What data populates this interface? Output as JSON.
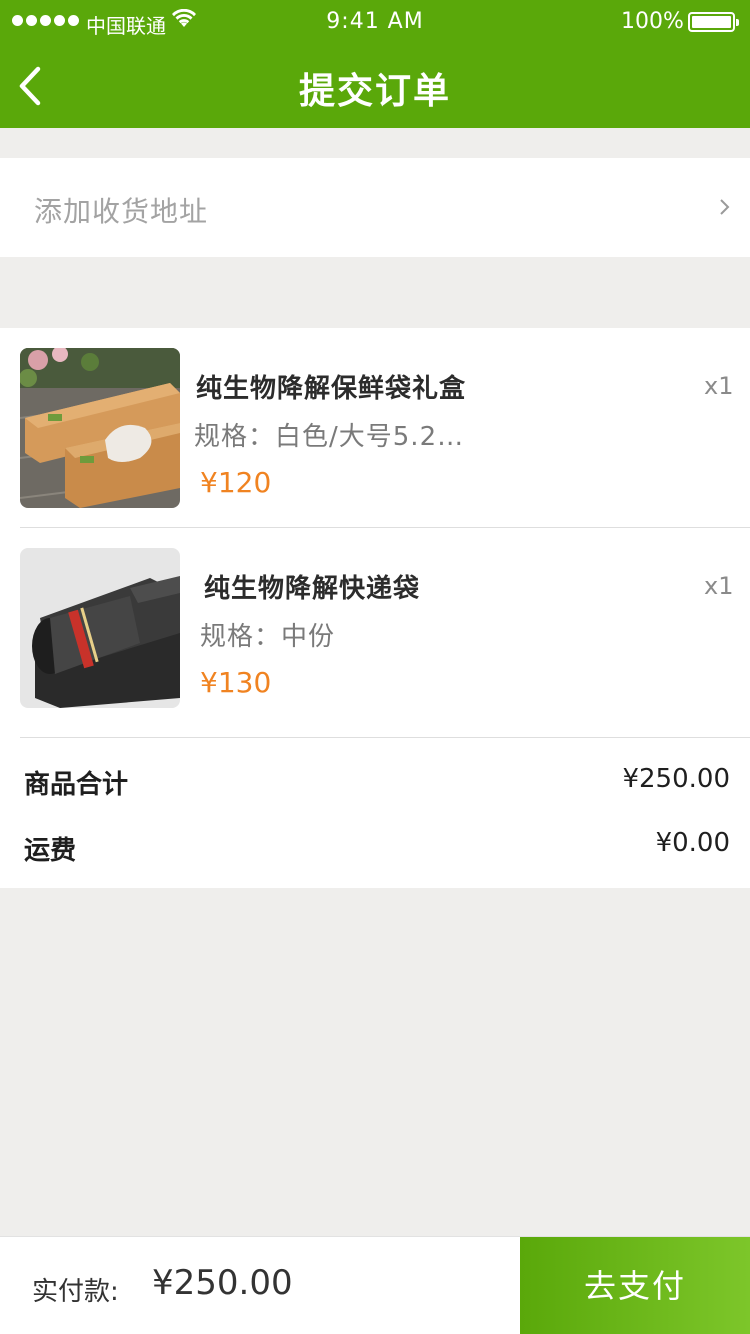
{
  "status_bar": {
    "carrier": "中国联通",
    "time": "9:41 AM",
    "battery": "100%"
  },
  "nav": {
    "title": "提交订单"
  },
  "address": {
    "label": "添加收货地址"
  },
  "items": [
    {
      "name": "纯生物降解保鲜袋礼盒",
      "spec": "规格：白色/大号5.2…",
      "price": "¥120",
      "qty": "x1"
    },
    {
      "name": "纯生物降解快递袋",
      "spec": "规格：中份",
      "price": "¥130",
      "qty": "x1"
    }
  ],
  "summary": {
    "subtotal_label": "商品合计",
    "subtotal_value": "¥250.00",
    "shipping_label": "运费",
    "shipping_value": "¥0.00"
  },
  "footer": {
    "pay_label": "实付款:",
    "pay_amount": "¥250.00",
    "pay_button": "去支付"
  },
  "colors": {
    "brand_green": "#5aa80a",
    "price_orange": "#f08321"
  }
}
